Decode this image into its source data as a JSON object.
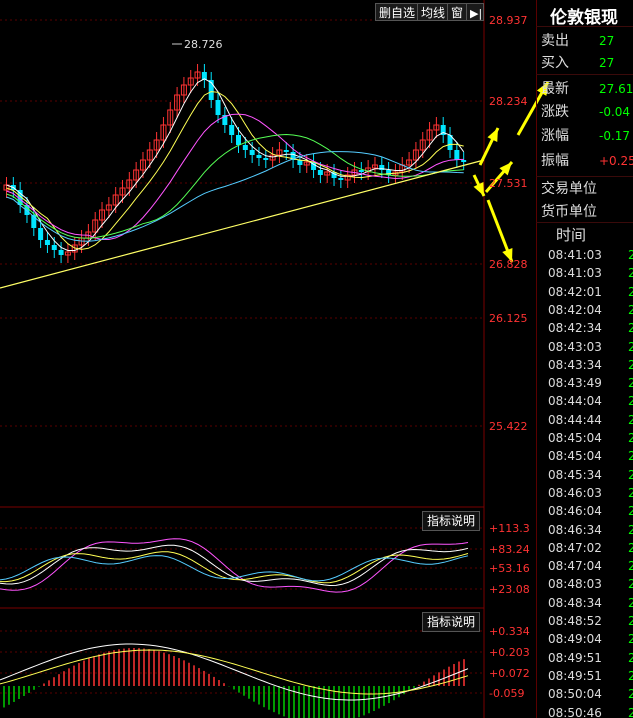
{
  "toolbar": {
    "delete_self_select": "删自选",
    "ma_line": "均线",
    "window": "窗",
    "pin_icon": "pin-icon"
  },
  "price_axis": {
    "ticks": [
      "28.937",
      "28.234",
      "27.531",
      "26.828",
      "26.125",
      "25.422"
    ],
    "peak_label": "28.726"
  },
  "indicator1": {
    "label": "指标说明",
    "ticks": [
      "+113.3",
      "+83.24",
      "+53.16",
      "+23.08"
    ]
  },
  "indicator2": {
    "label": "指标说明",
    "ticks": [
      "+0.334",
      "+0.203",
      "+0.072",
      "-0.059"
    ]
  },
  "quote": {
    "title": "伦敦银现",
    "rows": [
      {
        "label": "卖出",
        "value": "27",
        "color": "green"
      },
      {
        "label": "买入",
        "value": "27",
        "color": "green"
      },
      {
        "label": "最新",
        "value": "27.61",
        "color": "green"
      },
      {
        "label": "涨跌",
        "value": "-0.04",
        "color": "green"
      },
      {
        "label": "涨幅",
        "value": "-0.17",
        "color": "green"
      },
      {
        "label": "振幅",
        "value": "+0.25",
        "color": "red"
      },
      {
        "label": "交易单位",
        "value": "",
        "color": "green"
      },
      {
        "label": "货币单位",
        "value": "",
        "color": "green"
      }
    ]
  },
  "time_list": {
    "header": "时间",
    "rows": [
      "08:41:03",
      "08:41:03",
      "08:42:01",
      "08:42:04",
      "08:42:34",
      "08:43:03",
      "08:43:34",
      "08:43:49",
      "08:44:04",
      "08:44:44",
      "08:45:04",
      "08:45:04",
      "08:45:34",
      "08:46:03",
      "08:46:04",
      "08:46:34",
      "08:47:02",
      "08:47:04",
      "08:48:03",
      "08:48:34",
      "08:48:52",
      "08:49:04",
      "08:49:51",
      "08:49:51",
      "08:50:04",
      "08:50:46"
    ],
    "value_prefix": "2"
  },
  "colors": {
    "up": "#ff3333",
    "down": "#00e5ff",
    "grid": "#5a0000",
    "axis_text": "#ff3333",
    "annotation_arrow": "#ffff00"
  }
}
